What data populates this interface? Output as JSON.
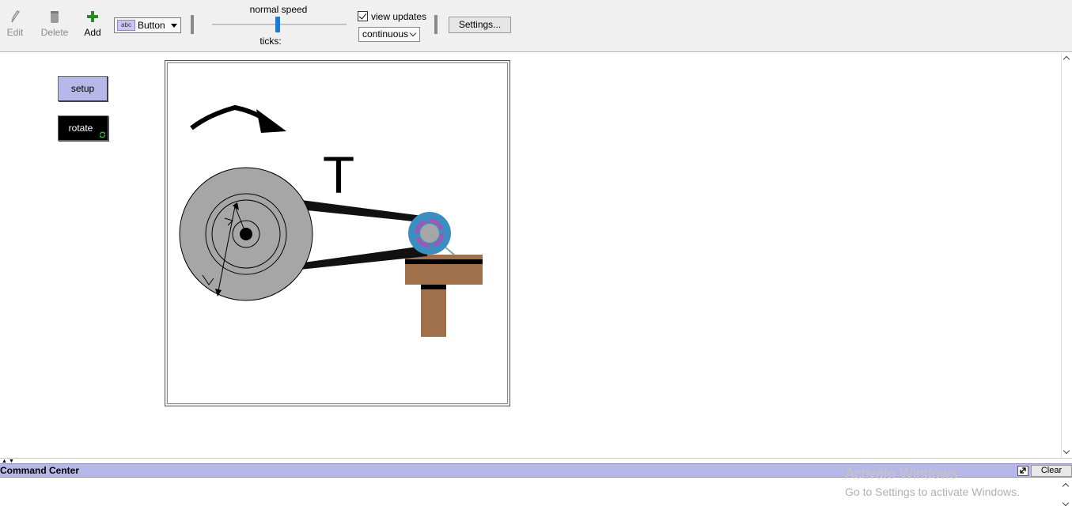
{
  "toolbar": {
    "edit_label": "Edit",
    "delete_label": "Delete",
    "add_label": "Add",
    "widget_type": "Button",
    "widget_icon_text": "abc",
    "speed_label": "normal speed",
    "speed_position": 0.49,
    "ticks_label": "ticks:",
    "view_updates_label": "view updates",
    "view_updates_checked": true,
    "update_mode": "continuous",
    "settings_label": "Settings..."
  },
  "interface": {
    "setup_label": "setup",
    "rotate_label": "rotate",
    "accent_button_color": "#b7b7ea"
  },
  "view": {
    "tension_label": "T",
    "wheel_color": "#a6a6a6",
    "motor_color": "#3b8fc0",
    "table_color": "#a0704b"
  },
  "command_center": {
    "title": "Command Center",
    "clear_label": "Clear"
  },
  "watermark": {
    "line1": "Activate Windows",
    "line2": "Go to Settings to activate Windows."
  }
}
